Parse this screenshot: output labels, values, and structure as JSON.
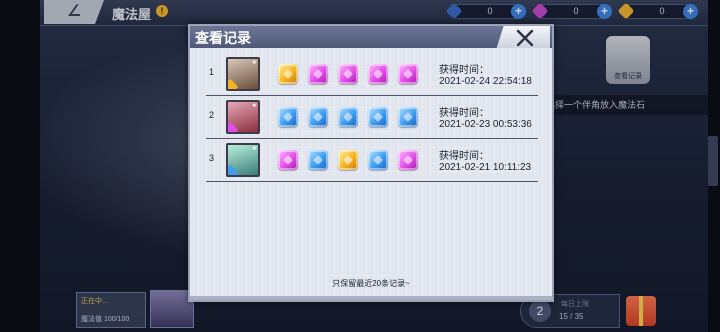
{
  "screen": {
    "back_label": "∠",
    "title": "魔法屋",
    "help_label": "!"
  },
  "resources": [
    {
      "name": "blue-crystal",
      "value": "0",
      "color": "#3b6cc7"
    },
    {
      "name": "purple-crystal",
      "value": "0",
      "color": "#c94ad0"
    },
    {
      "name": "gold-crystal",
      "value": "0",
      "color": "#f2b731"
    }
  ],
  "background": {
    "side_note": "选择一个伴角放入魔法石",
    "view_record_button": "查看记录",
    "bottom_left_line1": "正在中…",
    "bottom_left_line2": "魔法值 100/100",
    "bottom_right_number": "2",
    "bottom_right_label": "每日上限",
    "bottom_right_count": "15 / 35"
  },
  "modal": {
    "title": "查看记录",
    "footer_note": "只保留最近20条记录~",
    "time_label": "获得时间：",
    "records": [
      {
        "index": "1",
        "avatar_colors": [
          "#d9c8b8",
          "#6a4d3c"
        ],
        "avatar_gem": "#f3b321",
        "stones": [
          "gold",
          "purple",
          "purple",
          "purple",
          "purple"
        ],
        "time": "2021-02-24 22:54:18"
      },
      {
        "index": "2",
        "avatar_colors": [
          "#e7a7b8",
          "#8b2f3c"
        ],
        "avatar_gem": "#e24fe6",
        "stones": [
          "blue",
          "blue",
          "blue",
          "blue",
          "blue"
        ],
        "time": "2021-02-23 00:53:36"
      },
      {
        "index": "3",
        "avatar_colors": [
          "#b8f0dc",
          "#3a7d78"
        ],
        "avatar_gem": "#3d9df1",
        "stones": [
          "purple",
          "blue",
          "gold",
          "blue",
          "purple"
        ],
        "time": "2021-02-21 10:11:23"
      }
    ]
  }
}
